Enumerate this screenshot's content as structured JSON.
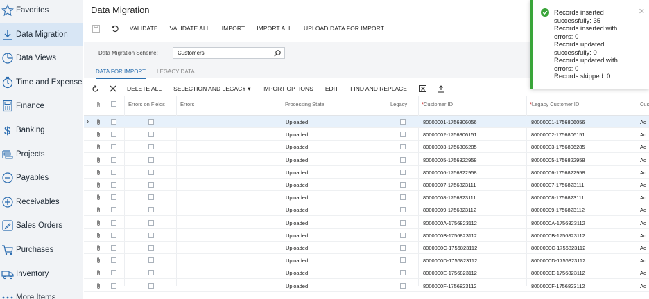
{
  "sidebar": {
    "items": [
      {
        "label": "Favorites",
        "icon": "star-icon"
      },
      {
        "label": "Data Migration",
        "icon": "download-arrow-icon"
      },
      {
        "label": "Data Views",
        "icon": "pie-chart-icon"
      },
      {
        "label": "Time and Expenses",
        "icon": "clock-icon"
      },
      {
        "label": "Finance",
        "icon": "calculator-icon"
      },
      {
        "label": "Banking",
        "icon": "dollar-icon"
      },
      {
        "label": "Projects",
        "icon": "projects-icon"
      },
      {
        "label": "Payables",
        "icon": "minus-circle-icon"
      },
      {
        "label": "Receivables",
        "icon": "plus-circle-icon"
      },
      {
        "label": "Sales Orders",
        "icon": "pencil-square-icon"
      },
      {
        "label": "Purchases",
        "icon": "cart-icon"
      },
      {
        "label": "Inventory",
        "icon": "truck-icon"
      },
      {
        "label": "More Items",
        "icon": "dots-icon"
      }
    ],
    "active_index": 1
  },
  "page": {
    "title": "Data Migration"
  },
  "toolbar": {
    "buttons": [
      "VALIDATE",
      "VALIDATE ALL",
      "IMPORT",
      "IMPORT ALL",
      "UPLOAD DATA FOR IMPORT"
    ]
  },
  "form": {
    "scheme_label": "Data Migration Scheme:",
    "scheme_value": "Customers"
  },
  "tabs": [
    "DATA FOR IMPORT",
    "LEGACY DATA"
  ],
  "grid_toolbar": {
    "buttons": [
      "DELETE ALL",
      "SELECTION AND LEGACY ▾",
      "IMPORT OPTIONS",
      "EDIT",
      "FIND AND REPLACE"
    ]
  },
  "grid": {
    "columns": [
      "Errors on Fields",
      "Errors",
      "Processing State",
      "Legacy",
      "Customer ID",
      "Legacy Customer ID",
      "Cus"
    ],
    "rows": [
      {
        "state": "Uploaded",
        "customer_id": "80000001-1756806056",
        "legacy_id": "80000001-1756806056",
        "cus": "Ac"
      },
      {
        "state": "Uploaded",
        "customer_id": "80000002-1756806151",
        "legacy_id": "80000002-1756806151",
        "cus": "Ac"
      },
      {
        "state": "Uploaded",
        "customer_id": "80000003-1756806285",
        "legacy_id": "80000003-1756806285",
        "cus": "Ac"
      },
      {
        "state": "Uploaded",
        "customer_id": "80000005-1756822958",
        "legacy_id": "80000005-1756822958",
        "cus": "Ac"
      },
      {
        "state": "Uploaded",
        "customer_id": "80000006-1756822958",
        "legacy_id": "80000006-1756822958",
        "cus": "Ac"
      },
      {
        "state": "Uploaded",
        "customer_id": "80000007-1756823111",
        "legacy_id": "80000007-1756823111",
        "cus": "Ac"
      },
      {
        "state": "Uploaded",
        "customer_id": "80000008-1756823111",
        "legacy_id": "80000008-1756823111",
        "cus": "Ac"
      },
      {
        "state": "Uploaded",
        "customer_id": "80000009-1756823112",
        "legacy_id": "80000009-1756823112",
        "cus": "Ac"
      },
      {
        "state": "Uploaded",
        "customer_id": "8000000A-1756823112",
        "legacy_id": "8000000A-1756823112",
        "cus": "Ac"
      },
      {
        "state": "Uploaded",
        "customer_id": "8000000B-1756823112",
        "legacy_id": "8000000B-1756823112",
        "cus": "Ac"
      },
      {
        "state": "Uploaded",
        "customer_id": "8000000C-1756823112",
        "legacy_id": "8000000C-1756823112",
        "cus": "Ac"
      },
      {
        "state": "Uploaded",
        "customer_id": "8000000D-1756823112",
        "legacy_id": "8000000D-1756823112",
        "cus": "Ac"
      },
      {
        "state": "Uploaded",
        "customer_id": "8000000E-1756823112",
        "legacy_id": "8000000E-1756823112",
        "cus": "Ac"
      },
      {
        "state": "Uploaded",
        "customer_id": "8000000F-1756823112",
        "legacy_id": "8000000F-1756823112",
        "cus": "Ac"
      }
    ]
  },
  "notification": {
    "lines": [
      "Records inserted successfully: 35",
      "Records inserted with errors: 0",
      "Records updated successfully: 0",
      "Records updated with errors: 0",
      "Records skipped: 0"
    ],
    "status_color": "#3aa53a"
  },
  "colors": {
    "accent": "#2a6fb0",
    "sidebar_bg": "#f1f3f6",
    "active_item": "#d8e6f5"
  }
}
